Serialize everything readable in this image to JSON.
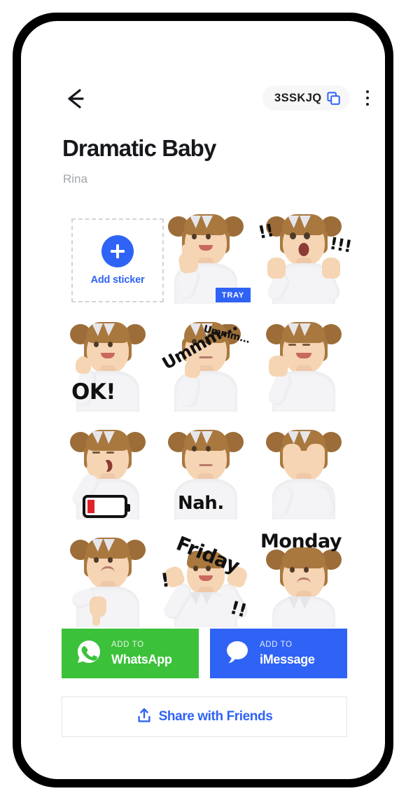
{
  "header": {
    "back_icon": "arrow-left-icon",
    "code": "3SSKJQ",
    "copy_icon": "copy-icon",
    "menu_icon": "kebab-menu-icon"
  },
  "pack": {
    "title": "Dramatic Baby",
    "author": "Rina"
  },
  "add_sticker": {
    "label": "Add sticker",
    "plus_icon": "plus-icon",
    "accent_color": "#2f63f5"
  },
  "tray_badge": "TRAY",
  "stickers": [
    {
      "name": "thumbs-up",
      "text": "",
      "badge": "TRAY"
    },
    {
      "name": "shocked",
      "text": "!!",
      "text2": "!!!"
    },
    {
      "name": "ok-gesture",
      "text": "OK!"
    },
    {
      "name": "thinking",
      "text": "Ummm...",
      "text2": "Ummm..."
    },
    {
      "name": "stop-hand",
      "text": ""
    },
    {
      "name": "tired-battery",
      "text": ""
    },
    {
      "name": "nah",
      "text": "Nah."
    },
    {
      "name": "covering-eyes",
      "text": ""
    },
    {
      "name": "thumbs-down",
      "text": ""
    },
    {
      "name": "friday",
      "text": "Friday",
      "text2": "!",
      "text3": "!!"
    },
    {
      "name": "monday",
      "text": "Monday"
    }
  ],
  "actions": {
    "whatsapp": {
      "kicker": "ADD TO",
      "name": "WhatsApp",
      "color": "#3cc13b",
      "icon": "whatsapp-icon"
    },
    "imessage": {
      "kicker": "ADD TO",
      "name": "iMessage",
      "color": "#2f63f5",
      "icon": "message-bubble-icon"
    },
    "share": {
      "label": "Share with Friends",
      "icon": "share-upload-icon",
      "color": "#2f63f5"
    }
  }
}
